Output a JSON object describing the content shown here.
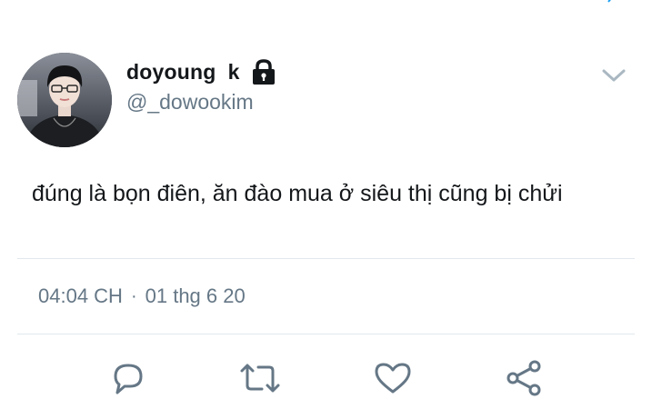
{
  "tweet": {
    "author": {
      "display_name": "doyoung  k",
      "handle": "@_dowookim",
      "protected_icon": "lock-icon",
      "avatar": "profile-photo"
    },
    "text": "đúng là bọn điên, ăn đào mua ở siêu thị cũng bị chửi",
    "time": "04:04 CH",
    "separator": "·",
    "date": "01 thg 6 20",
    "menu_icon": "chevron-down-icon"
  },
  "actions": [
    {
      "icon": "reply-icon"
    },
    {
      "icon": "retweet-icon"
    },
    {
      "icon": "like-icon"
    },
    {
      "icon": "share-icon"
    }
  ],
  "colors": {
    "text_primary": "#14171a",
    "text_secondary": "#657786",
    "icon": "#657786",
    "divider": "#e1e8ed",
    "accent": "#1da1f2"
  }
}
